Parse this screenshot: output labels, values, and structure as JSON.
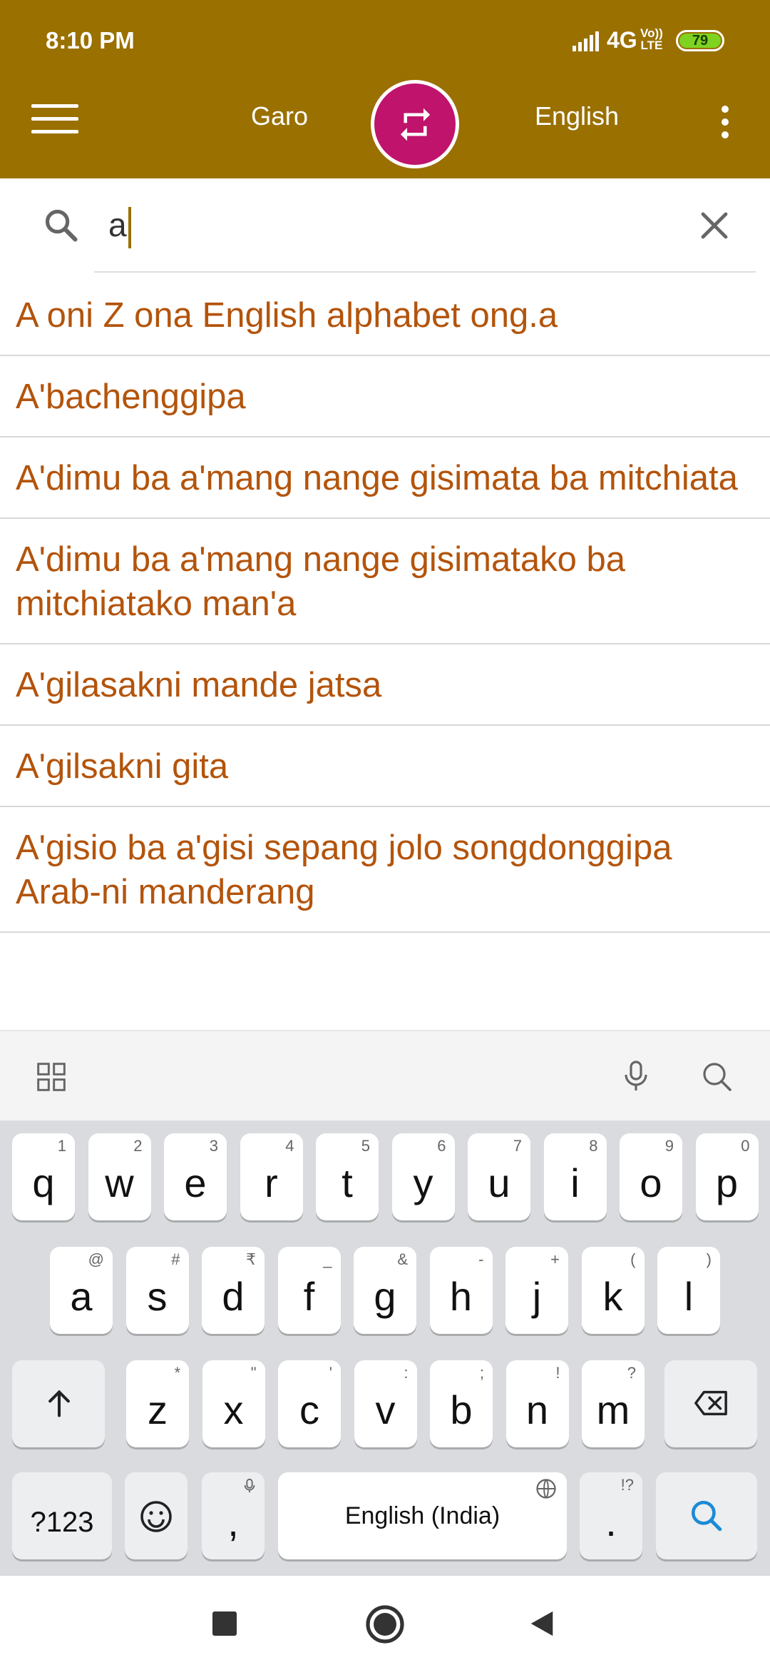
{
  "status_bar": {
    "time": "8:10 PM",
    "network": "4G",
    "volte_top": "Vo))",
    "volte_bottom": "LTE",
    "battery": "79"
  },
  "toolbar": {
    "source_language": "Garo",
    "target_language": "English"
  },
  "search": {
    "query": "a"
  },
  "results": [
    "A oni Z ona English alphabet ong.a",
    "A'bachenggipa",
    "A'dimu ba a'mang nange gisimata ba mitchiata",
    "A'dimu ba a'mang nange gisimatako ba mitchiatako man'a",
    "A'gilasakni mande jatsa",
    "A'gilsakni gita",
    "A'gisio ba a'gisi sepang jolo songdonggipa Arab-ni manderang"
  ],
  "keyboard": {
    "row1": [
      {
        "k": "q",
        "h": "1"
      },
      {
        "k": "w",
        "h": "2"
      },
      {
        "k": "e",
        "h": "3"
      },
      {
        "k": "r",
        "h": "4"
      },
      {
        "k": "t",
        "h": "5"
      },
      {
        "k": "y",
        "h": "6"
      },
      {
        "k": "u",
        "h": "7"
      },
      {
        "k": "i",
        "h": "8"
      },
      {
        "k": "o",
        "h": "9"
      },
      {
        "k": "p",
        "h": "0"
      }
    ],
    "row2": [
      {
        "k": "a",
        "h": "@"
      },
      {
        "k": "s",
        "h": "#"
      },
      {
        "k": "d",
        "h": "₹"
      },
      {
        "k": "f",
        "h": "_"
      },
      {
        "k": "g",
        "h": "&"
      },
      {
        "k": "h",
        "h": "-"
      },
      {
        "k": "j",
        "h": "+"
      },
      {
        "k": "k",
        "h": "("
      },
      {
        "k": "l",
        "h": ")"
      }
    ],
    "row3": [
      {
        "k": "z",
        "h": "*"
      },
      {
        "k": "x",
        "h": "\""
      },
      {
        "k": "c",
        "h": "'"
      },
      {
        "k": "v",
        "h": ":"
      },
      {
        "k": "b",
        "h": ";"
      },
      {
        "k": "n",
        "h": "!"
      },
      {
        "k": "m",
        "h": "?"
      }
    ],
    "symbols_key": "?123",
    "comma_key": ",",
    "space_label": "English (India)",
    "period_key": ".",
    "period_hint": "!?"
  }
}
